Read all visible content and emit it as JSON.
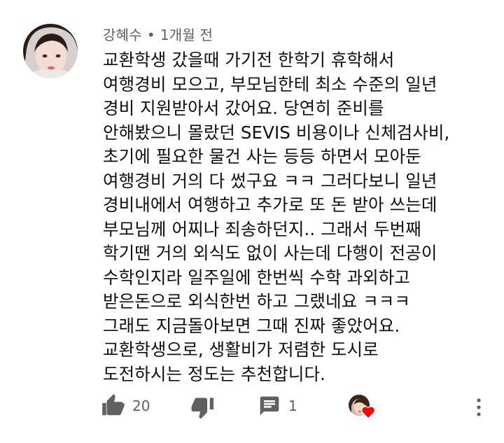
{
  "comment": {
    "author": "강혜수",
    "separator": "•",
    "time": "1개월 전",
    "lines": [
      "교환학생 갔을때 가기전 한학기 휴학해서",
      "여행경비 모으고, 부모님한테 최소 수준의 일년",
      "경비 지원받아서 갔어요. 당연히 준비를",
      "안해봤으니 몰랐던 SEVIS 비용이나 신체검사비,",
      "초기에 필요한 물건 사는 등등 하면서 모아둔",
      "여행경비 거의 다 썼구요 ㅋㅋ 그러다보니 일년",
      "경비내에서 여행하고 추가로 또 돈 받아 쓰는데",
      "부모님께 어찌나 죄송하던지.. 그래서 두번째",
      "학기땐 거의 외식도 없이 사는데 다행이 전공이",
      "수학인지라 일주일에 한번씩 수학 과외하고",
      "받은돈으로 외식한번 하고 그랬네요 ㅋㅋㅋ",
      "그래도 지금돌아보면 그때 진짜 좋았어요.",
      "교환학생으로, 생활비가 저렴한 도시로",
      "도전하시는 정도는 추천합니다."
    ]
  },
  "actions": {
    "like_count": "20",
    "reply_count": "1"
  },
  "icons": {
    "like": "thumbs-up-icon",
    "dislike": "thumbs-down-icon",
    "reply": "comment-icon",
    "creator_heart": "heart-icon",
    "more": "more-vertical-icon"
  },
  "colors": {
    "icon": "#606060",
    "heart": "#ff0000",
    "meta_text": "#606060"
  }
}
